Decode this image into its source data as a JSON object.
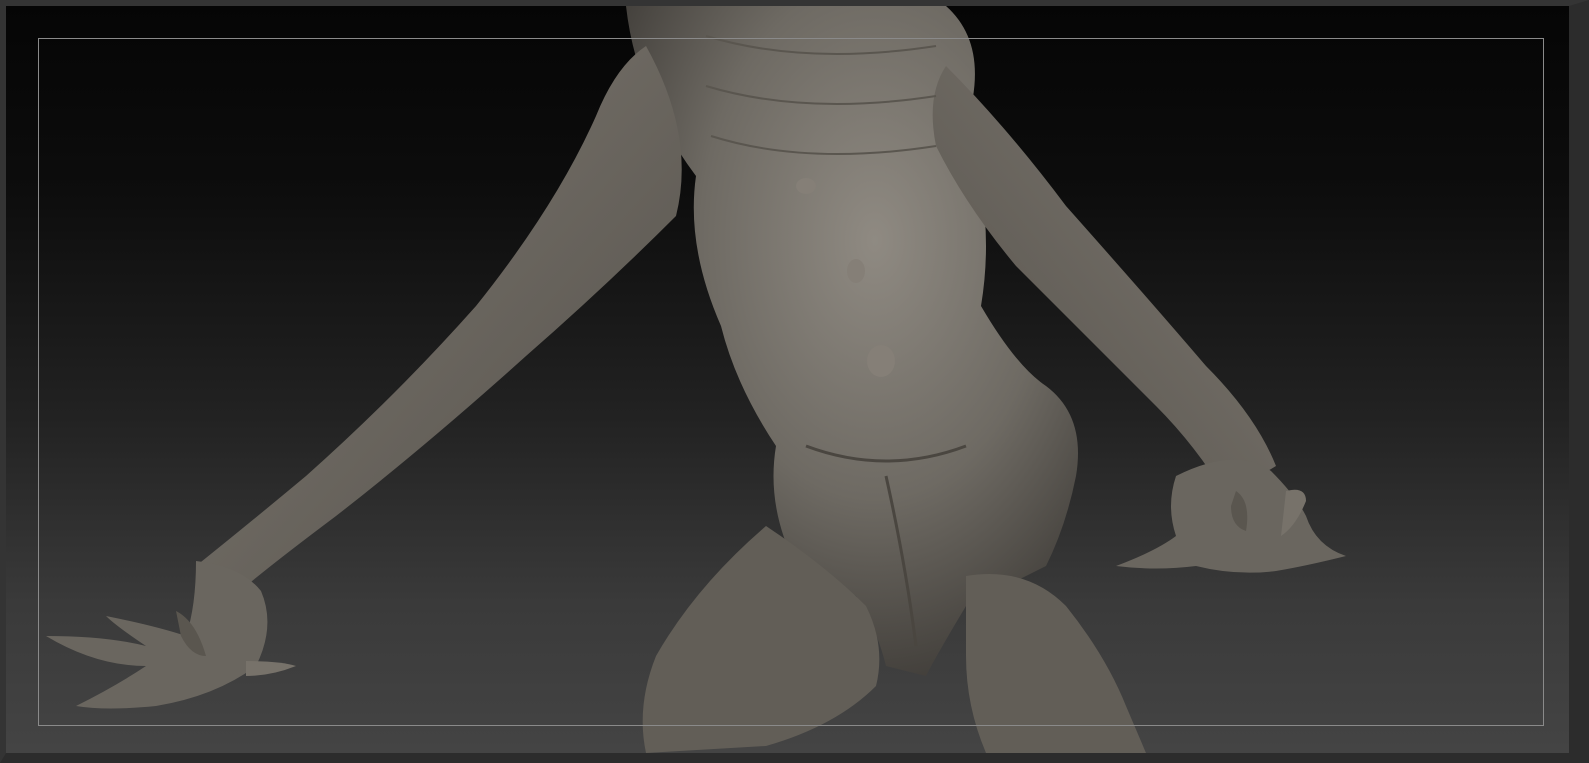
{
  "viewport": {
    "background_top": "#050505",
    "background_bottom": "#444444",
    "frame_color": "#8a8a8a",
    "model_color": "#6e6a63",
    "model_highlight": "#8f8a82",
    "model_shadow": "#3d3a36"
  },
  "model": {
    "icon": "sculpt-model-icon"
  }
}
